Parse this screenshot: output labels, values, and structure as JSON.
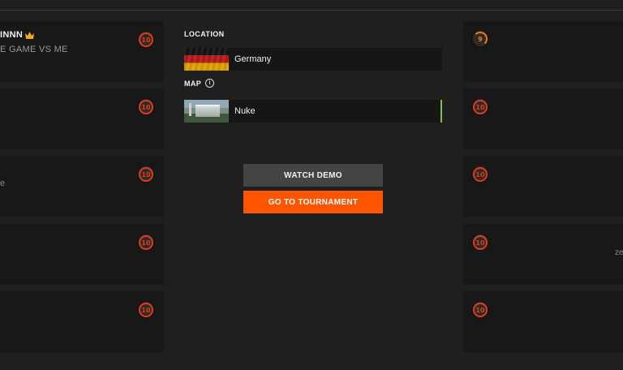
{
  "left_cards": [
    {
      "name": "INNN",
      "subtitle": "E GAME VS ME",
      "level": "10",
      "crown": true
    },
    {
      "name": "",
      "subtitle": "",
      "level": "10"
    },
    {
      "name": "",
      "subtitle": "e",
      "level": "10"
    },
    {
      "name": "",
      "subtitle": "",
      "level": "10"
    },
    {
      "name": "",
      "subtitle": "",
      "level": "10"
    }
  ],
  "right_cards": [
    {
      "level": "9",
      "side_text": ""
    },
    {
      "level": "10",
      "side_text": ""
    },
    {
      "level": "10",
      "side_text": ""
    },
    {
      "level": "10",
      "side_text": "ze"
    },
    {
      "level": "10",
      "side_text": ""
    }
  ],
  "match": {
    "location_label": "LOCATION",
    "location": "Germany",
    "map_label": "MAP",
    "map": "Nuke",
    "watch_demo": "WATCH DEMO",
    "go_to_tournament": "GO TO TOURNAMENT"
  },
  "colors": {
    "accent_orange": "#ff5500",
    "level_red": "#e23a19",
    "level_orange": "#f07a12",
    "map_selected": "#7bc242"
  }
}
